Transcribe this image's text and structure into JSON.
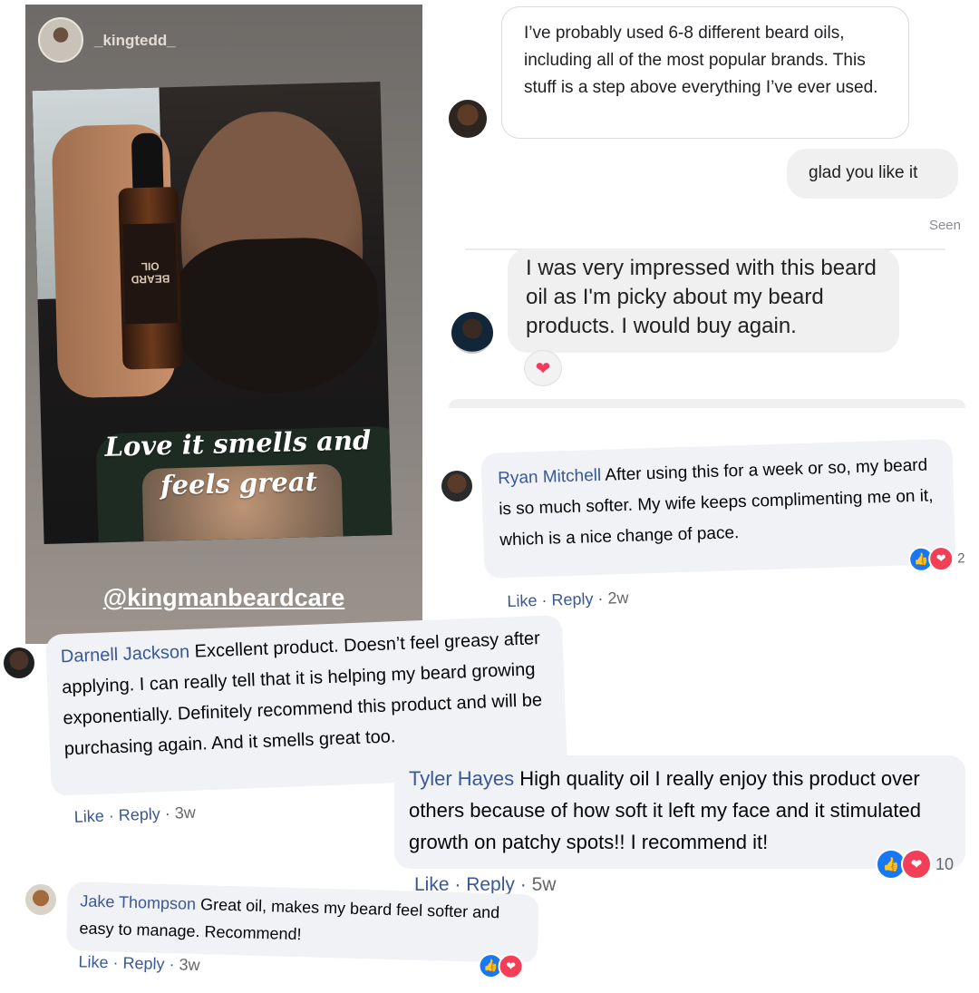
{
  "story": {
    "username": "_kingtedd_",
    "bottle_label": "BEARD OIL",
    "caption_line1": "Love it smells and",
    "caption_line2": "feels great",
    "handle": "@kingmanbeardcare"
  },
  "messenger": {
    "msg1": "I’ve probably used 6-8 different beard oils, including all of the most popular brands. This stuff is a step above everything I’ve ever used.",
    "reply": "glad you like it",
    "seen": "Seen",
    "msg2": "I was very impressed with this beard oil as I'm picky about my beard products. I would buy again.",
    "reaction_icon": "heart"
  },
  "comments": [
    {
      "name": "Ryan Mitchell",
      "text": "After using this for a week or so, my beard is so much softer. My wife keeps complimenting me on it, which is a nice change of pace.",
      "like": "Like",
      "reply": "Reply",
      "time": "2w",
      "reaction_count": "2"
    },
    {
      "name": "Darnell Jackson",
      "text": "Excellent product. Doesn’t feel greasy after applying. I can really tell that it is helping my beard growing exponentially. Definitely recommend this product and will be purchasing again. And it smells great too.",
      "like": "Like",
      "reply": "Reply",
      "time": "3w"
    },
    {
      "name": "Tyler Hayes",
      "text": "High quality oil I really enjoy this product over others because of how soft it left my face and it stimulated growth on patchy spots!! I recommend it!",
      "like": "Like",
      "reply": "Reply",
      "time": "5w",
      "reaction_count": "10"
    },
    {
      "name": "Jake Thompson",
      "text": "Great oil, makes my beard feel softer and easy to manage. Recommend!",
      "like": "Like",
      "reply": "Reply",
      "time": "3w"
    }
  ],
  "colors": {
    "fb_link": "#385898",
    "fb_bubble": "#f0f2f5",
    "like_blue": "#1877f2",
    "love_red": "#f33e58"
  }
}
